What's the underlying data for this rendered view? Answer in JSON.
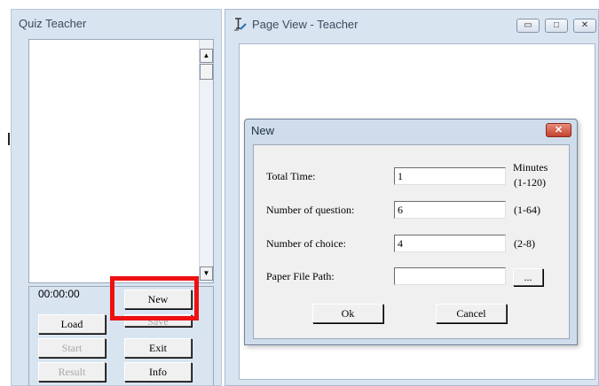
{
  "quiz_panel": {
    "title": "Quiz Teacher",
    "timer": "00:00:00",
    "buttons": {
      "new": "New",
      "save": "Save",
      "load": "Load",
      "exit": "Exit",
      "start": "Start",
      "info": "Info",
      "result": "Result"
    }
  },
  "page_view": {
    "title": "Page View - Teacher",
    "caption_buttons": {
      "minimize": "▭",
      "maximize": "□",
      "close": "✕"
    }
  },
  "new_dialog": {
    "title": "New",
    "close_symbol": "✕",
    "fields": {
      "total_time": {
        "label": "Total Time:",
        "value": "1",
        "hint_line1": "Minutes",
        "hint_line2": "(1-120)"
      },
      "num_question": {
        "label": "Number of question:",
        "value": "6",
        "hint": "(1-64)"
      },
      "num_choice": {
        "label": "Number of choice:",
        "value": "4",
        "hint": "(2-8)"
      },
      "paper_path": {
        "label": "Paper File Path:",
        "value": "",
        "browse": "..."
      }
    },
    "ok": "Ok",
    "cancel": "Cancel"
  },
  "colors": {
    "panel_bg": "#d9e4f1",
    "highlight": "#ee1111",
    "dialog_close": "#c5412d"
  },
  "icons": {
    "page_view_icon": "text-edit-icon"
  }
}
